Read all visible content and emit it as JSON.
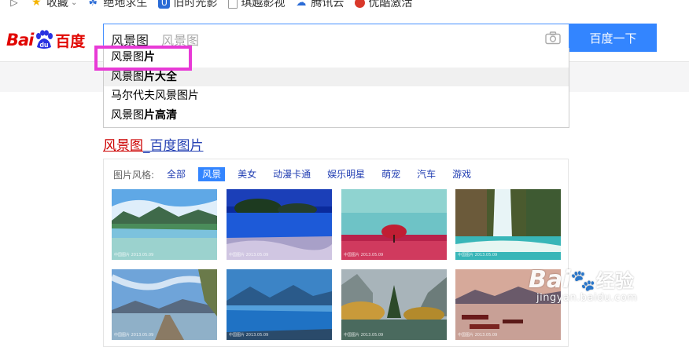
{
  "bookmarks": [
    {
      "label": "收藏",
      "icon": "star-icon",
      "color": "#f5b400",
      "dropdown": true
    },
    {
      "label": "绝地求生",
      "icon": "paw-icon",
      "color": "#2a6bd6"
    },
    {
      "label": "旧时光影",
      "icon": "u-letter-icon",
      "color": "#2a6bd6"
    },
    {
      "label": "琪越影视",
      "icon": "page-icon",
      "color": "#999999"
    },
    {
      "label": "腾讯云",
      "icon": "cloud-icon",
      "color": "#2a6bd6"
    },
    {
      "label": "优酷激活",
      "icon": "penguin-icon",
      "color": "#d9382a"
    }
  ],
  "logo": {
    "bai": "Bai",
    "cn": "百度"
  },
  "search": {
    "typed": "风景图",
    "hint": "风景图",
    "button": "百度一下"
  },
  "suggestions": [
    {
      "prefix": "风景图",
      "bold": "片"
    },
    {
      "prefix": "风景图",
      "bold": "片大全"
    },
    {
      "prefix": "马尔代夫风景图片",
      "bold": ""
    },
    {
      "prefix": "风景图",
      "bold": "片高清"
    }
  ],
  "result": {
    "keyword": "风景图",
    "rest": "_百度图片"
  },
  "image_styles": {
    "label": "图片风格:",
    "tags": [
      "全部",
      "风景",
      "美女",
      "动漫卡通",
      "娱乐明星",
      "萌宠",
      "汽车",
      "游戏"
    ],
    "active_index": 1
  },
  "thumbnails": [
    {
      "caption": "中国图片 2013.05.09",
      "scene": "lake-mountain"
    },
    {
      "caption": "中国图片 2013.05.09",
      "scene": "blue-lake-night"
    },
    {
      "caption": "中国图片 2013.05.09",
      "scene": "red-tree"
    },
    {
      "caption": "中国图片 2013.05.09",
      "scene": "waterfall"
    },
    {
      "caption": "中国图片 2013.05.09",
      "scene": "pier"
    },
    {
      "caption": "中国图片 2013.05.09",
      "scene": "blue-mountain-lake"
    },
    {
      "caption": "中国图片 2013.05.09",
      "scene": "autumn-valley"
    },
    {
      "caption": "中国图片 2013.05.09",
      "scene": "boats-sunset"
    }
  ],
  "watermark": {
    "logo": "Bai",
    "suffix": "经验",
    "url": "jingyan.baidu.com"
  },
  "colors": {
    "accent": "#3385ff",
    "link": "#2440b3",
    "keyword_red": "#cc0000",
    "highlight": "#e83ad6"
  }
}
